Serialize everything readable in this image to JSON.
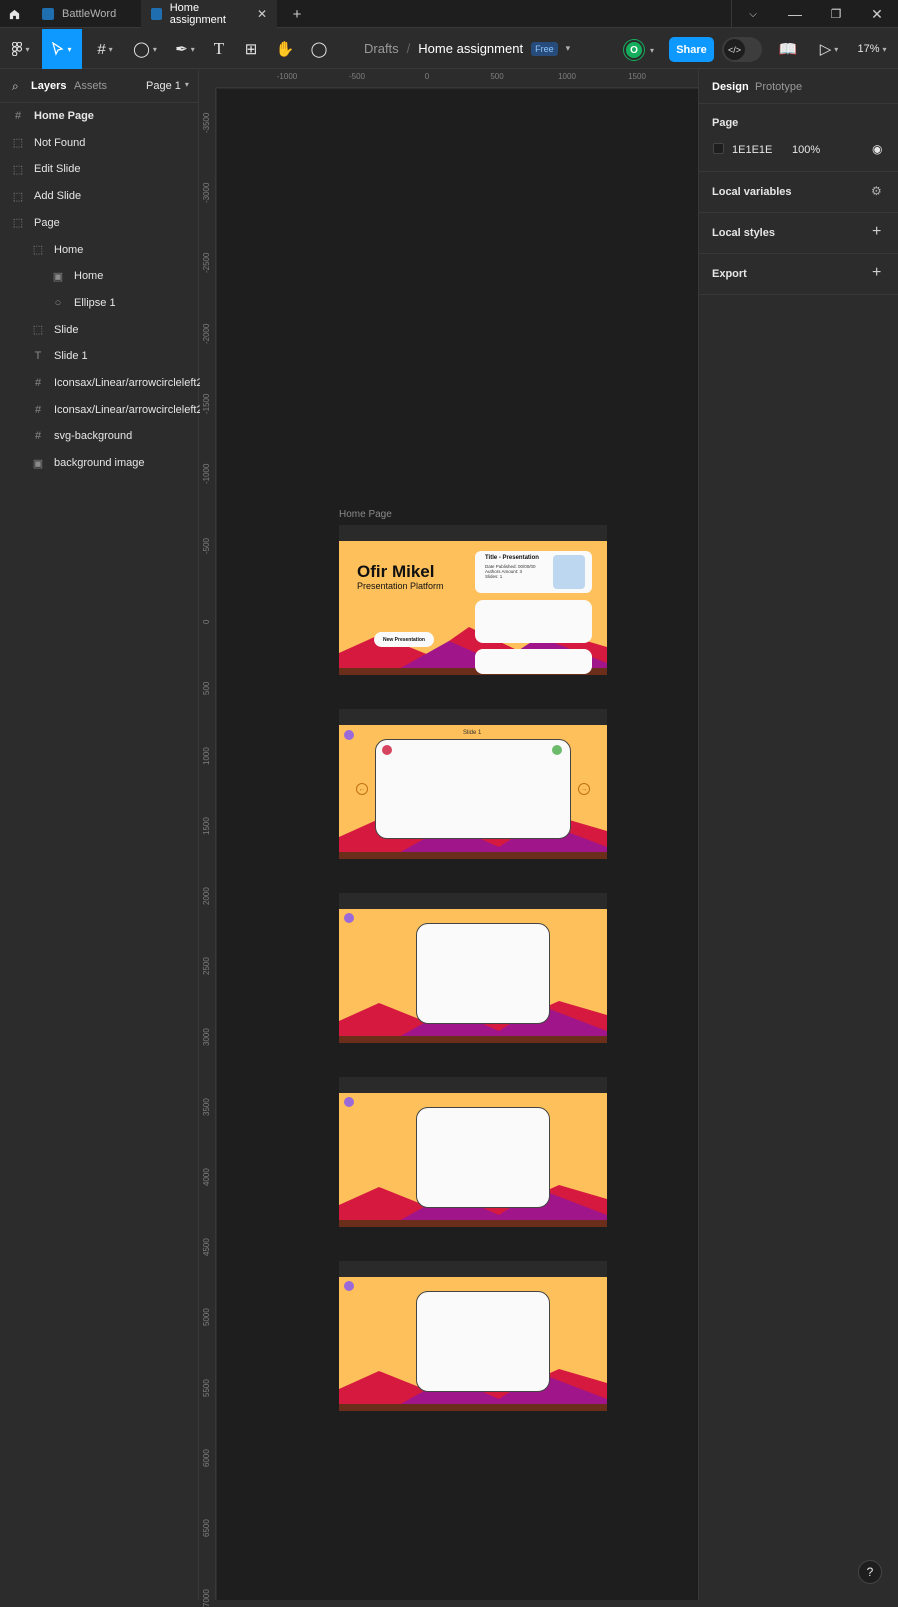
{
  "tabs": [
    {
      "label": "BattleWord"
    },
    {
      "label": "Home assignment"
    }
  ],
  "tab_add_label": "+",
  "breadcrumb": {
    "parent": "Drafts",
    "separator": "/",
    "file": "Home assignment",
    "plan_badge": "Free"
  },
  "toolbar": {
    "avatar_initial": "O",
    "share_label": "Share",
    "zoom_label": "17%"
  },
  "left_panel": {
    "tab_layers": "Layers",
    "tab_assets": "Assets",
    "page_selector": "Page 1",
    "layers": [
      {
        "label": "Home Page",
        "icon": "frame-icon",
        "indent": 0,
        "bold": true
      },
      {
        "label": "Not Found",
        "icon": "section-icon",
        "indent": 0
      },
      {
        "label": "Edit Slide",
        "icon": "section-icon",
        "indent": 0
      },
      {
        "label": "Add Slide",
        "icon": "section-icon",
        "indent": 0
      },
      {
        "label": "Page",
        "icon": "section-icon",
        "indent": 0
      },
      {
        "label": "Home",
        "icon": "section-icon",
        "indent": 1
      },
      {
        "label": "Home",
        "icon": "image-icon",
        "indent": 2
      },
      {
        "label": "Ellipse 1",
        "icon": "ellipse-icon",
        "indent": 2
      },
      {
        "label": "Slide",
        "icon": "section-icon",
        "indent": 1
      },
      {
        "label": "Slide 1",
        "icon": "text-icon",
        "indent": 1
      },
      {
        "label": "Iconsax/Linear/arrowcircleleft2",
        "icon": "frame-icon",
        "indent": 1
      },
      {
        "label": "Iconsax/Linear/arrowcircleleft2",
        "icon": "frame-icon",
        "indent": 1
      },
      {
        "label": "svg-background",
        "icon": "frame-icon",
        "indent": 1
      },
      {
        "label": "background image",
        "icon": "image-icon",
        "indent": 1
      }
    ]
  },
  "rulers": {
    "horizontal": [
      "-1000",
      "-500",
      "0",
      "500",
      "1000",
      "1500"
    ],
    "vertical": [
      "-3500",
      "-3000",
      "-2500",
      "-2000",
      "-1500",
      "-1000",
      "-500",
      "0",
      "500",
      "1000",
      "1500",
      "2000",
      "2500",
      "3000",
      "3500",
      "4000",
      "4500",
      "5000",
      "5500",
      "6000",
      "6500",
      "7000"
    ]
  },
  "canvas": {
    "frame_label": "Home Page",
    "home_slide": {
      "title": "Ofir Mikel",
      "subtitle": "Presentation Platform",
      "button": "New Presentation",
      "card_title": "Title - Presentation",
      "card_lines": [
        "Date Published: 00/00/00",
        "Authors Amount: 3",
        "Slides: 1"
      ]
    },
    "slide_title": "Slide 1"
  },
  "right_panel": {
    "tab_design": "Design",
    "tab_prototype": "Prototype",
    "page_section": "Page",
    "page_color_hex": "1E1E1E",
    "page_opacity": "100%",
    "local_variables": "Local variables",
    "local_styles": "Local styles",
    "export": "Export"
  },
  "help_label": "?",
  "colors": {
    "accent": "#0d99ff",
    "canvas_bg": "#1e1e1e",
    "panel_bg": "#2c2c2c",
    "slide_bg": "#fdc05a",
    "mountain_red": "#d6193f",
    "mountain_purple": "#a0168a",
    "avatar": "#14ae5c"
  }
}
